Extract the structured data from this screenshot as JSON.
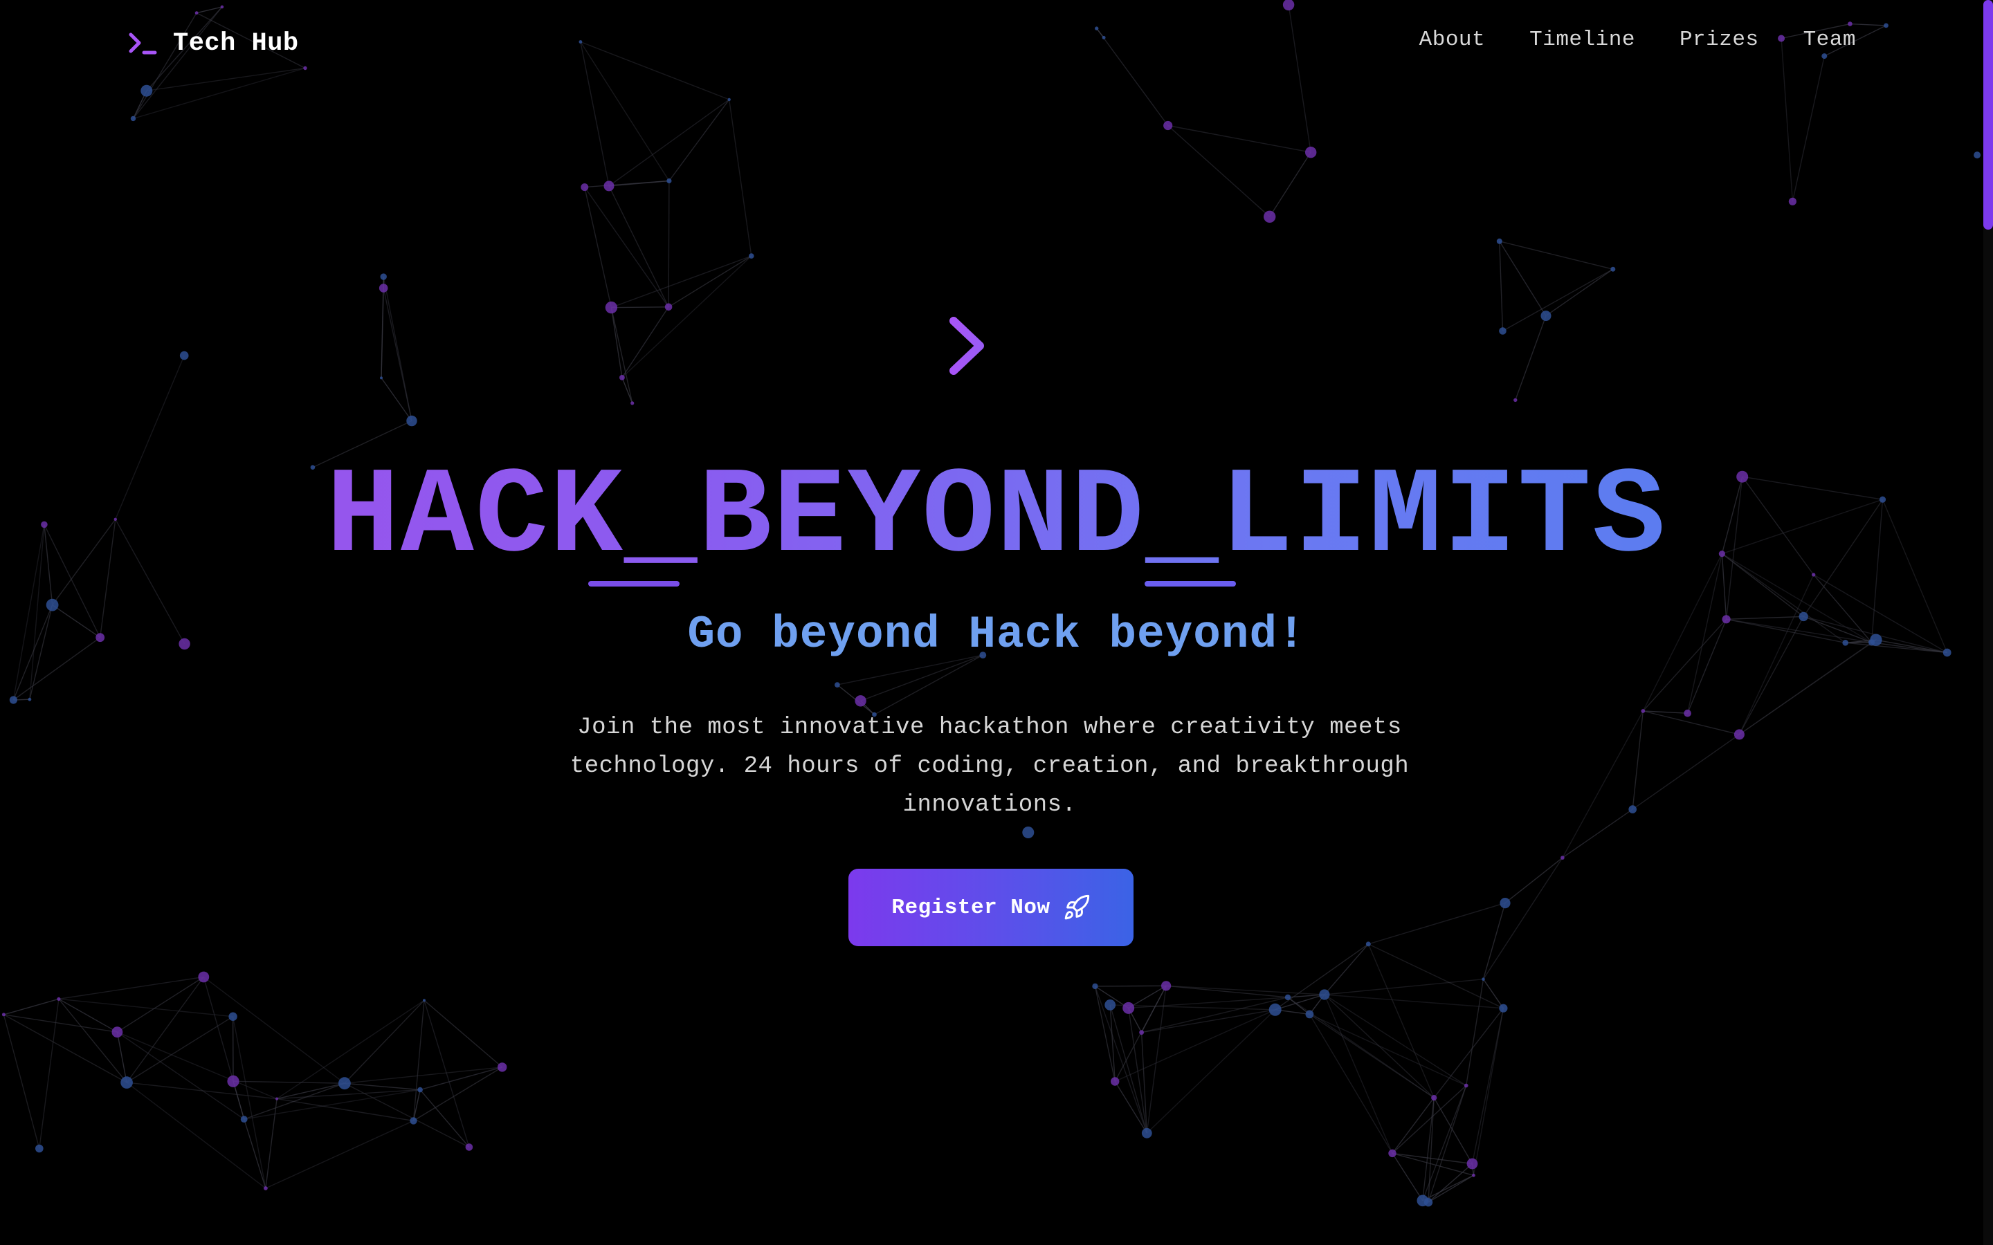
{
  "colors": {
    "background": "#000000",
    "accent_purple": "#a855f7",
    "accent_blue": "#3b82f6",
    "subtitle_blue": "#6fa0f0",
    "node_purple": "#6b2fa8",
    "node_blue": "#2e4f93",
    "line": "#3a3a44",
    "text_light": "#d6d6d6"
  },
  "navbar": {
    "brand": {
      "icon": "terminal-prompt-icon",
      "name": "Tech Hub"
    },
    "links": [
      {
        "label": "About"
      },
      {
        "label": "Timeline"
      },
      {
        "label": "Prizes"
      },
      {
        "label": "Team"
      }
    ]
  },
  "hero": {
    "icon": "terminal-prompt-icon",
    "title": "HACK_BEYOND_LIMITS",
    "subtitle": "Go beyond Hack beyond!",
    "description": "Join the most innovative hackathon where creativity meets technology. 24 hours of coding, creation, and breakthrough innovations.",
    "cta": {
      "label": "Register Now",
      "icon": "rocket-icon"
    }
  },
  "background": {
    "style": "particle-network",
    "icon": "network-graph"
  }
}
